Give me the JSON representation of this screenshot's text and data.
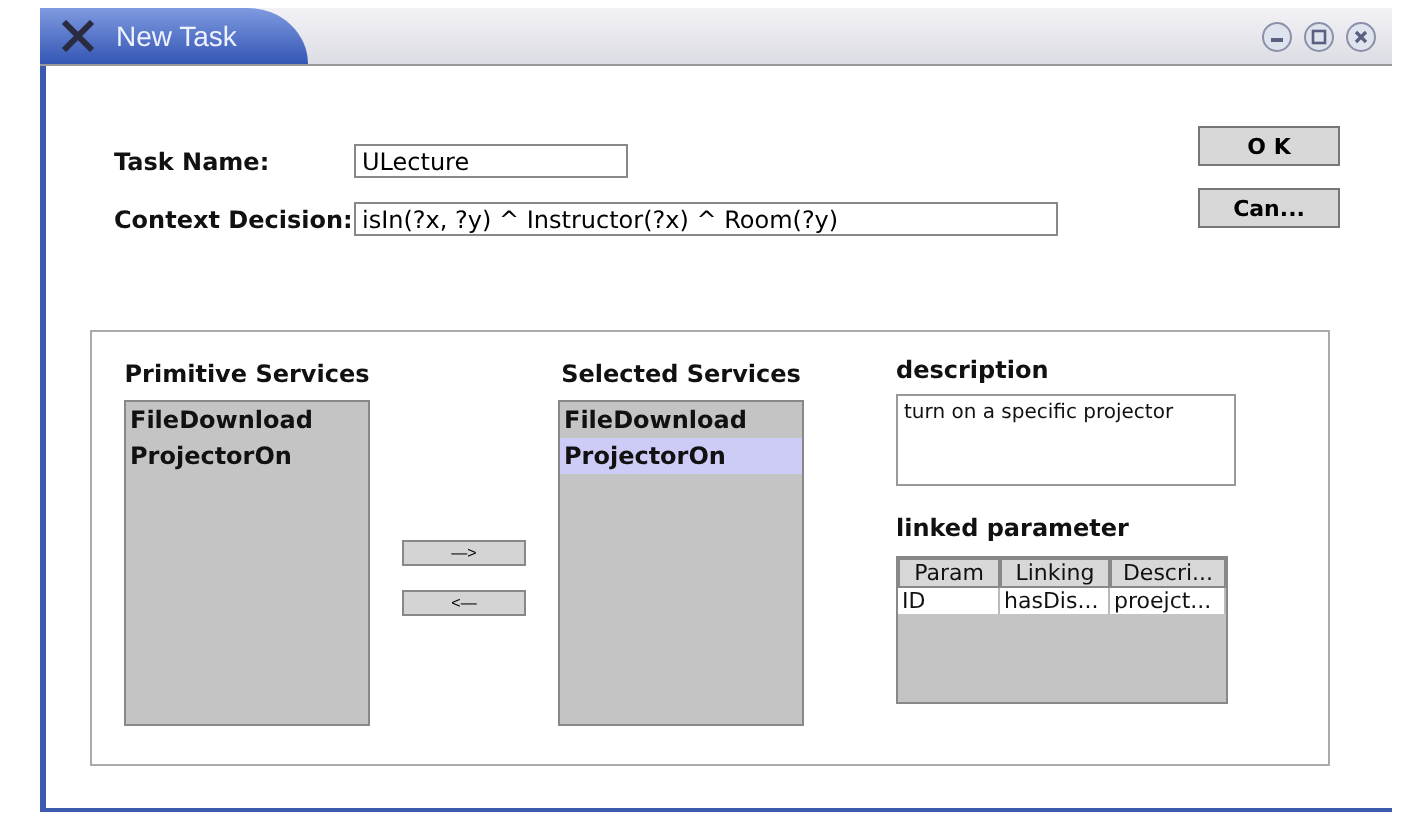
{
  "window": {
    "title": "New Task"
  },
  "form": {
    "task_name_label": "Task Name:",
    "task_name_value": "ULecture",
    "context_label": "Context Decision:",
    "context_value": "isIn(?x, ?y) ^ Instructor(?x) ^ Room(?y)"
  },
  "buttons": [
    "O K",
    "Can..."
  ],
  "primitive_services": {
    "title": "Primitive Services",
    "items": [
      {
        "label": "FileDownload",
        "selected": false
      },
      {
        "label": "ProjectorOn",
        "selected": false
      }
    ]
  },
  "move_buttons": [
    "—>",
    "<—"
  ],
  "selected_services": {
    "title": "Selected Services",
    "items": [
      {
        "label": "FileDownload",
        "selected": false
      },
      {
        "label": "ProjectorOn",
        "selected": true
      }
    ]
  },
  "description": {
    "label": "description",
    "value": "turn on a specific projector"
  },
  "linked_parameter": {
    "label": "linked parameter",
    "columns": [
      "Param",
      "Linking",
      "Descri..."
    ],
    "rows": [
      [
        "ID",
        "hasDis...",
        "proejct..."
      ]
    ]
  }
}
